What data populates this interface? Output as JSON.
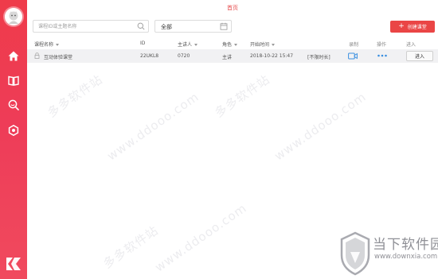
{
  "app": {
    "page_title": "首页"
  },
  "sidebar": {
    "nav": [
      {
        "name": "home",
        "icon": "home-icon"
      },
      {
        "name": "book",
        "icon": "book-icon"
      },
      {
        "name": "search-course",
        "icon": "search-zoom-icon"
      },
      {
        "name": "settings",
        "icon": "gear-hexagon-icon"
      }
    ]
  },
  "toolbar": {
    "search_placeholder": "课程ID或主题名称",
    "filter_value": "全部",
    "create_label": "创建课堂"
  },
  "table": {
    "headers": {
      "name": "课程名称",
      "id": "ID",
      "lecturer": "主讲人",
      "role": "角色",
      "start_time": "开始时间",
      "record": "录制",
      "actions": "操作",
      "enter": "进入"
    },
    "rows": [
      {
        "name": "互动体验课堂",
        "id": "22UKL8",
        "lecturer": "0720",
        "role": "主讲",
        "start_time": "2018-10-22 15:47",
        "duration": "[不限时长]",
        "enter_label": "进入"
      }
    ]
  },
  "watermark": {
    "site_text": "多多软件站",
    "site_url": "www.ddooo.com",
    "brand_name": "当下软件园",
    "brand_url": "www.downxia.com"
  },
  "colors": {
    "accent": "#ea4545",
    "sidebar": "#ef3b4a",
    "video_icon": "#3a8fe0"
  }
}
